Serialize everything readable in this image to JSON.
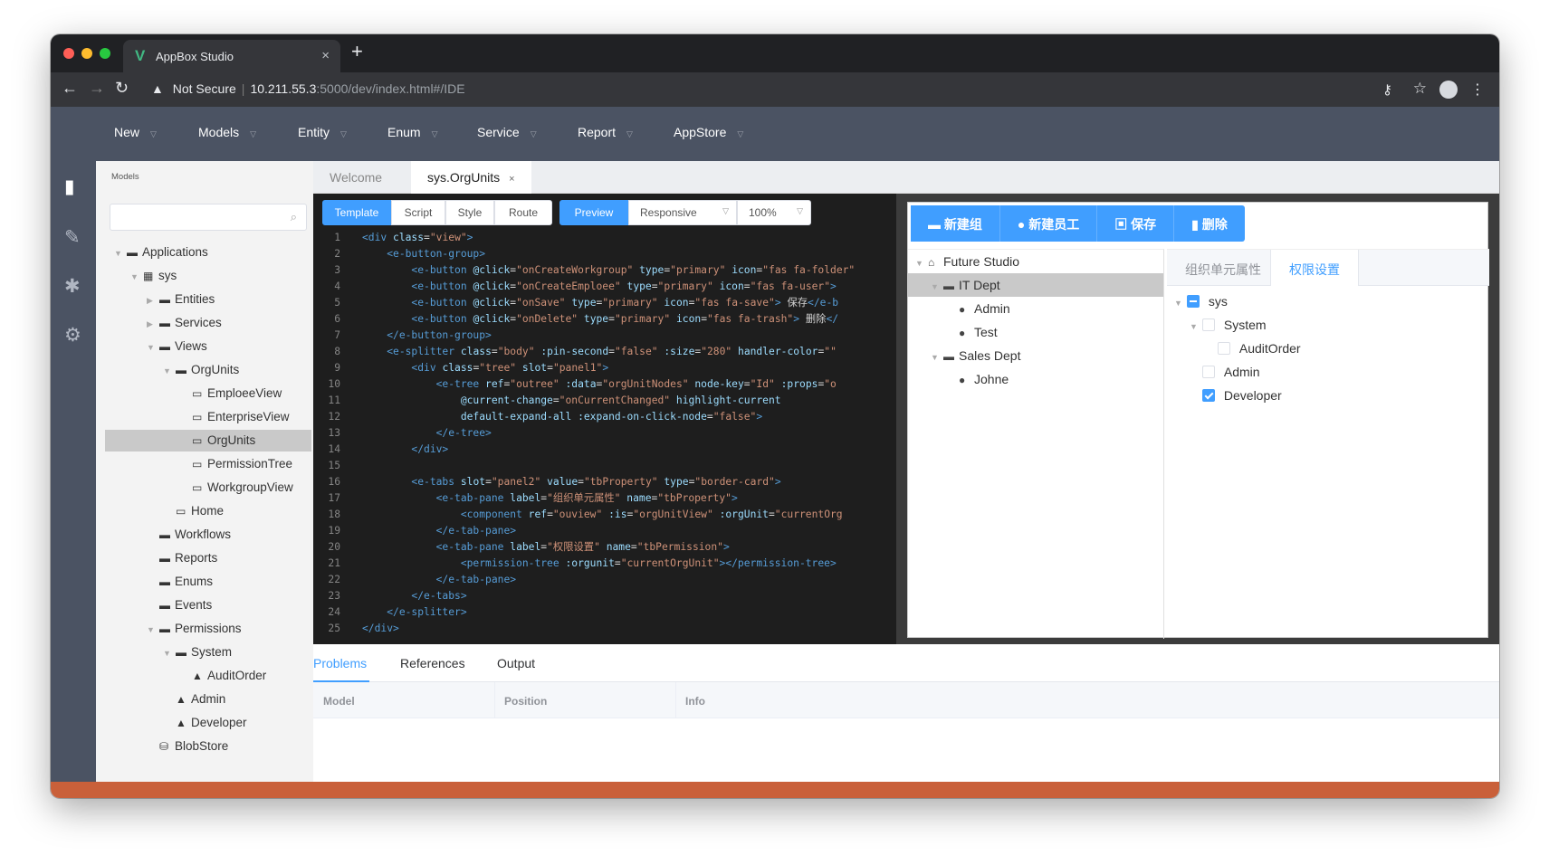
{
  "browser": {
    "tab_title": "AppBox Studio",
    "tab_close": "×",
    "new_tab": "+",
    "security": "Not Secure",
    "url_host": "10.211.55.3",
    "url_rest": ":5000/dev/index.html#/IDE"
  },
  "menu": [
    "New",
    "Models",
    "Entity",
    "Enum",
    "Service",
    "Report",
    "AppStore"
  ],
  "sidebar": {
    "header": "Models",
    "tree": [
      {
        "label": "Applications",
        "icon": "folder",
        "arrow": "▼",
        "depth": 0
      },
      {
        "label": "sys",
        "icon": "grid",
        "arrow": "▼",
        "depth": 1
      },
      {
        "label": "Entities",
        "icon": "folder",
        "arrow": "▶",
        "depth": 2
      },
      {
        "label": "Services",
        "icon": "folder",
        "arrow": "▶",
        "depth": 2
      },
      {
        "label": "Views",
        "icon": "folder",
        "arrow": "▼",
        "depth": 2
      },
      {
        "label": "OrgUnits",
        "icon": "folder",
        "arrow": "▼",
        "depth": 3
      },
      {
        "label": "EmploeeView",
        "icon": "window",
        "arrow": "",
        "depth": 4
      },
      {
        "label": "EnterpriseView",
        "icon": "window",
        "arrow": "",
        "depth": 4
      },
      {
        "label": "OrgUnits",
        "icon": "window",
        "arrow": "",
        "depth": 4,
        "selected": true
      },
      {
        "label": "PermissionTree",
        "icon": "window",
        "arrow": "",
        "depth": 4
      },
      {
        "label": "WorkgroupView",
        "icon": "window",
        "arrow": "",
        "depth": 4
      },
      {
        "label": "Home",
        "icon": "window",
        "arrow": "",
        "depth": 3
      },
      {
        "label": "Workflows",
        "icon": "folder",
        "arrow": "",
        "depth": 2
      },
      {
        "label": "Reports",
        "icon": "folder",
        "arrow": "",
        "depth": 2
      },
      {
        "label": "Enums",
        "icon": "folder",
        "arrow": "",
        "depth": 2
      },
      {
        "label": "Events",
        "icon": "folder",
        "arrow": "",
        "depth": 2
      },
      {
        "label": "Permissions",
        "icon": "folder",
        "arrow": "▼",
        "depth": 2
      },
      {
        "label": "System",
        "icon": "folder",
        "arrow": "▼",
        "depth": 3
      },
      {
        "label": "AuditOrder",
        "icon": "lock",
        "arrow": "",
        "depth": 4
      },
      {
        "label": "Admin",
        "icon": "lock",
        "arrow": "",
        "depth": 3
      },
      {
        "label": "Developer",
        "icon": "lock",
        "arrow": "",
        "depth": 3
      },
      {
        "label": "BlobStore",
        "icon": "database",
        "arrow": "",
        "depth": 2
      }
    ]
  },
  "doc_tabs": {
    "welcome": "Welcome",
    "active": "sys.OrgUnits",
    "close": "×"
  },
  "editor_toolbar": {
    "template": "Template",
    "script": "Script",
    "style": "Style",
    "route": "Route",
    "preview": "Preview",
    "responsive": "Responsive",
    "zoom": "100%"
  },
  "code_lines": [
    {
      "n": "1",
      "html": "<span class='tg'>&lt;div</span> <span class='at'>class</span>=<span class='st'>\"view\"</span><span class='tg'>&gt;</span>"
    },
    {
      "n": "2",
      "html": "    <span class='tg'>&lt;e-button-group&gt;</span>"
    },
    {
      "n": "3",
      "html": "        <span class='tg'>&lt;e-button</span> <span class='at'>@click</span>=<span class='st'>\"onCreateWorkgroup\"</span> <span class='at'>type</span>=<span class='st'>\"primary\"</span> <span class='at'>icon</span>=<span class='st'>\"fas fa-folder\"</span>"
    },
    {
      "n": "4",
      "html": "        <span class='tg'>&lt;e-button</span> <span class='at'>@click</span>=<span class='st'>\"onCreateEmploee\"</span> <span class='at'>type</span>=<span class='st'>\"primary\"</span> <span class='at'>icon</span>=<span class='st'>\"fas fa-user\"</span><span class='tg'>&gt;</span>"
    },
    {
      "n": "5",
      "html": "        <span class='tg'>&lt;e-button</span> <span class='at'>@click</span>=<span class='st'>\"onSave\"</span> <span class='at'>type</span>=<span class='st'>\"primary\"</span> <span class='at'>icon</span>=<span class='st'>\"fas fa-save\"</span><span class='tg'>&gt;</span> 保存<span class='tg'>&lt;/e-b</span>"
    },
    {
      "n": "6",
      "html": "        <span class='tg'>&lt;e-button</span> <span class='at'>@click</span>=<span class='st'>\"onDelete\"</span> <span class='at'>type</span>=<span class='st'>\"primary\"</span> <span class='at'>icon</span>=<span class='st'>\"fas fa-trash\"</span><span class='tg'>&gt;</span> 删除<span class='tg'>&lt;/</span>"
    },
    {
      "n": "7",
      "html": "    <span class='tg'>&lt;/e-button-group&gt;</span>"
    },
    {
      "n": "8",
      "html": "    <span class='tg'>&lt;e-splitter</span> <span class='at'>class</span>=<span class='st'>\"body\"</span> <span class='at'>:pin-second</span>=<span class='st'>\"false\"</span> <span class='at'>:size</span>=<span class='st'>\"280\"</span> <span class='at'>handler-color</span>=<span class='st'>\"\"</span>"
    },
    {
      "n": "9",
      "html": "        <span class='tg'>&lt;div</span> <span class='at'>class</span>=<span class='st'>\"tree\"</span> <span class='at'>slot</span>=<span class='st'>\"panel1\"</span><span class='tg'>&gt;</span>"
    },
    {
      "n": "10",
      "html": "            <span class='tg'>&lt;e-tree</span> <span class='at'>ref</span>=<span class='st'>\"outree\"</span> <span class='at'>:data</span>=<span class='st'>\"orgUnitNodes\"</span> <span class='at'>node-key</span>=<span class='st'>\"Id\"</span> <span class='at'>:props</span>=<span class='st'>\"o</span>"
    },
    {
      "n": "11",
      "html": "                <span class='at'>@current-change</span>=<span class='st'>\"onCurrentChanged\"</span> <span class='at'>highlight-current</span>"
    },
    {
      "n": "12",
      "html": "                <span class='at'>default-expand-all</span> <span class='at'>:expand-on-click-node</span>=<span class='st'>\"false\"</span><span class='tg'>&gt;</span>"
    },
    {
      "n": "13",
      "html": "            <span class='tg'>&lt;/e-tree&gt;</span>"
    },
    {
      "n": "14",
      "html": "        <span class='tg'>&lt;/div&gt;</span>"
    },
    {
      "n": "15",
      "html": ""
    },
    {
      "n": "16",
      "html": "        <span class='tg'>&lt;e-tabs</span> <span class='at'>slot</span>=<span class='st'>\"panel2\"</span> <span class='at'>value</span>=<span class='st'>\"tbProperty\"</span> <span class='at'>type</span>=<span class='st'>\"border-card\"</span><span class='tg'>&gt;</span>"
    },
    {
      "n": "17",
      "html": "            <span class='tg'>&lt;e-tab-pane</span> <span class='at'>label</span>=<span class='st'>\"组织单元属性\"</span> <span class='at'>name</span>=<span class='st'>\"tbProperty\"</span><span class='tg'>&gt;</span>"
    },
    {
      "n": "18",
      "html": "                <span class='tg'>&lt;component</span> <span class='at'>ref</span>=<span class='st'>\"ouview\"</span> <span class='at'>:is</span>=<span class='st'>\"orgUnitView\"</span> <span class='at'>:orgUnit</span>=<span class='st'>\"currentOrg</span>"
    },
    {
      "n": "19",
      "html": "            <span class='tg'>&lt;/e-tab-pane&gt;</span>"
    },
    {
      "n": "20",
      "html": "            <span class='tg'>&lt;e-tab-pane</span> <span class='at'>label</span>=<span class='st'>\"权限设置\"</span> <span class='at'>name</span>=<span class='st'>\"tbPermission\"</span><span class='tg'>&gt;</span>"
    },
    {
      "n": "21",
      "html": "                <span class='tg'>&lt;permission-tree</span> <span class='at'>:orgunit</span>=<span class='st'>\"currentOrgUnit\"</span><span class='tg'>&gt;&lt;/permission-tree&gt;</span>"
    },
    {
      "n": "22",
      "html": "            <span class='tg'>&lt;/e-tab-pane&gt;</span>"
    },
    {
      "n": "23",
      "html": "        <span class='tg'>&lt;/e-tabs&gt;</span>"
    },
    {
      "n": "24",
      "html": "    <span class='tg'>&lt;/e-splitter&gt;</span>"
    },
    {
      "n": "25",
      "html": "<span class='tg'>&lt;/div&gt;</span>"
    }
  ],
  "preview": {
    "buttons": [
      {
        "icon": "folder-icon",
        "glyph": "▬",
        "label": "新建组"
      },
      {
        "icon": "user-icon",
        "glyph": "●",
        "label": "新建员工"
      },
      {
        "icon": "save-icon",
        "glyph": "▣",
        "label": "保存"
      },
      {
        "icon": "trash-icon",
        "glyph": "▮",
        "label": "删除"
      }
    ],
    "org_tree": [
      {
        "label": "Future Studio",
        "icon": "home",
        "arrow": "▼",
        "depth": 0
      },
      {
        "label": "IT Dept",
        "icon": "folder",
        "arrow": "▼",
        "depth": 1,
        "selected": true
      },
      {
        "label": "Admin",
        "icon": "user",
        "arrow": "",
        "depth": 2
      },
      {
        "label": "Test",
        "icon": "user",
        "arrow": "",
        "depth": 2
      },
      {
        "label": "Sales Dept",
        "icon": "folder",
        "arrow": "▼",
        "depth": 1
      },
      {
        "label": "Johne",
        "icon": "user",
        "arrow": "",
        "depth": 2
      }
    ],
    "tabs": {
      "property": "组织单元属性",
      "permission": "权限设置"
    },
    "perm_tree": [
      {
        "label": "sys",
        "arrow": "▼",
        "depth": 0,
        "state": "indeterminate"
      },
      {
        "label": "System",
        "arrow": "▼",
        "depth": 1,
        "state": "unchecked"
      },
      {
        "label": "AuditOrder",
        "arrow": "",
        "depth": 2,
        "state": "unchecked"
      },
      {
        "label": "Admin",
        "arrow": "",
        "depth": 1,
        "state": "unchecked"
      },
      {
        "label": "Developer",
        "arrow": "",
        "depth": 1,
        "state": "checked"
      }
    ]
  },
  "bottom": {
    "tabs": [
      "Problems",
      "References",
      "Output"
    ],
    "columns": [
      "Model",
      "Position",
      "Info"
    ]
  },
  "colors": {
    "accent": "#409eff",
    "menubar": "#4b5363",
    "status": "#c9603a"
  }
}
